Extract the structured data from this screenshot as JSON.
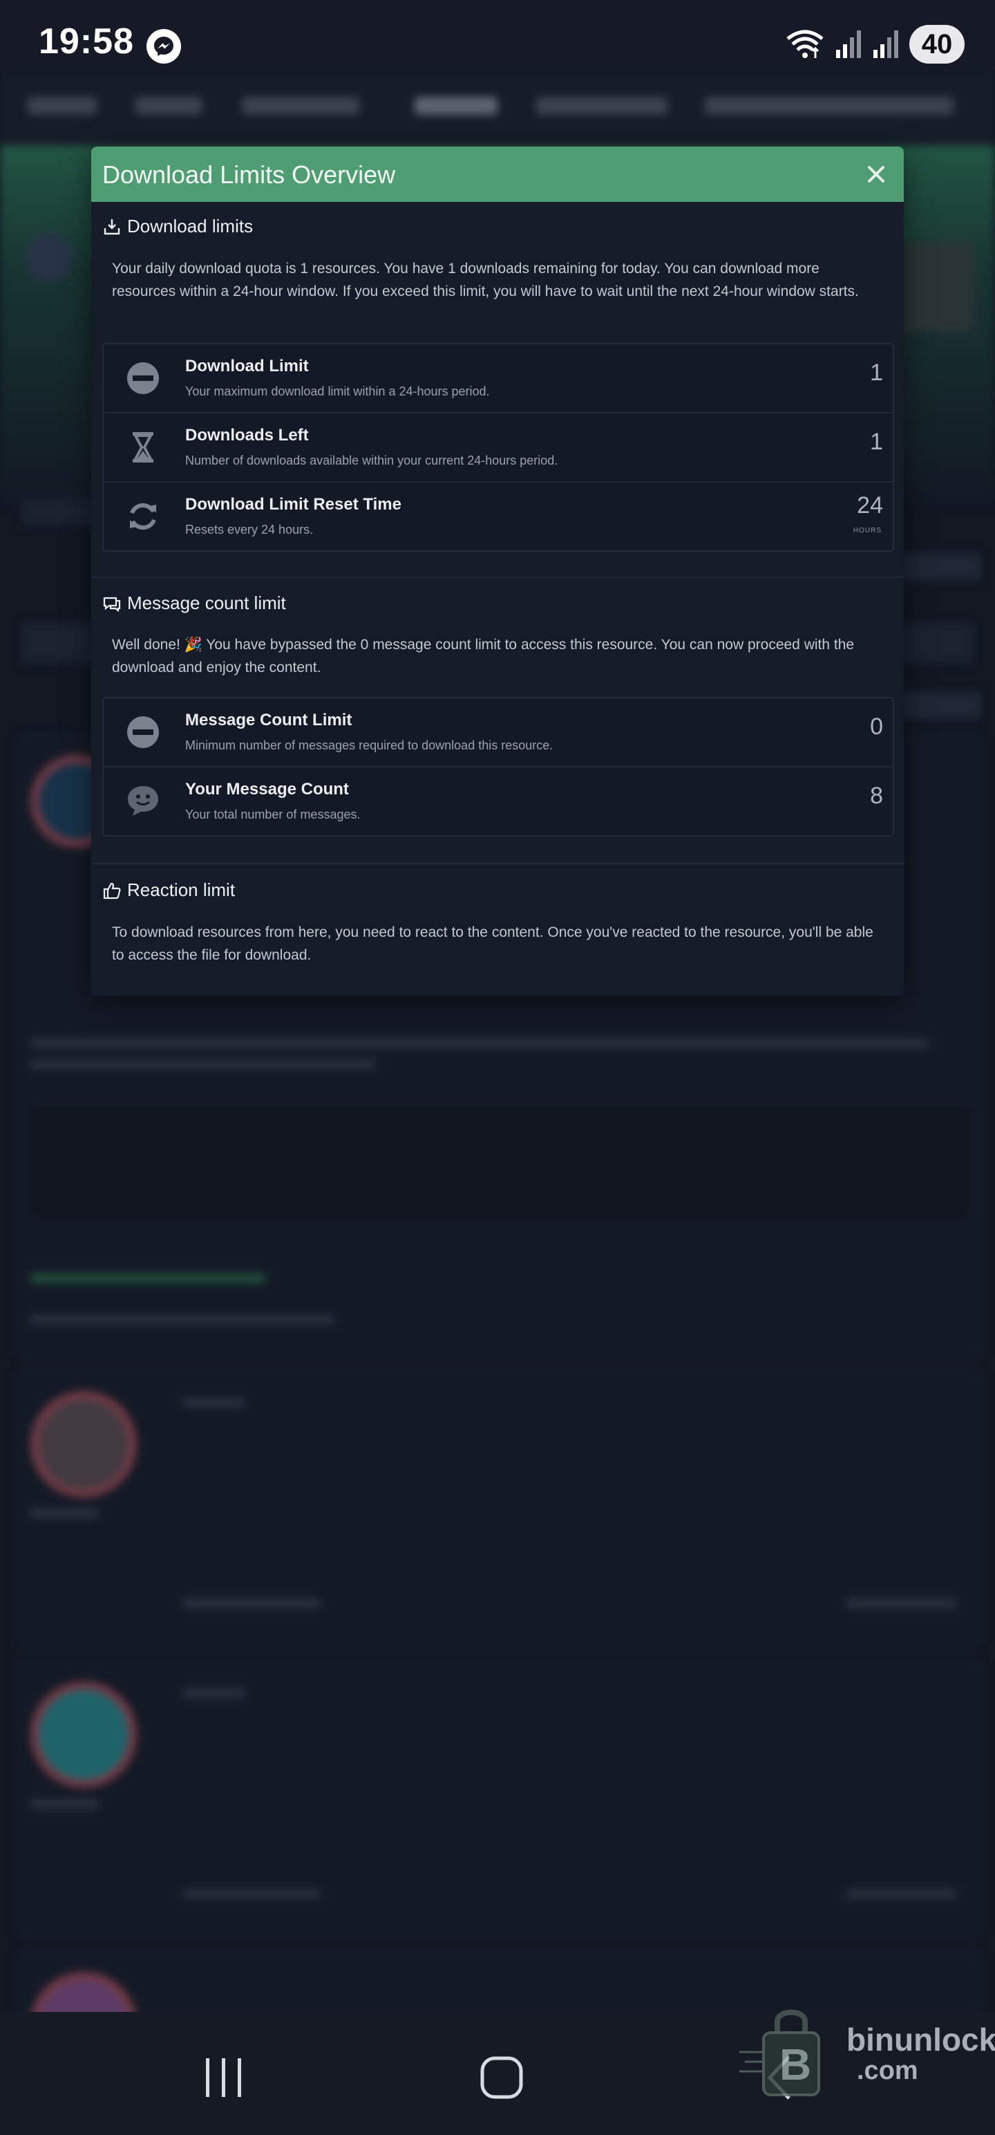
{
  "status_bar": {
    "time": "19:58",
    "battery": "40"
  },
  "modal": {
    "title": "Download Limits Overview",
    "download_section": {
      "heading": "Download limits",
      "description": "Your daily download quota is 1 resources. You have 1 downloads remaining for today. You can download more resources within a 24-hour window. If you exceed this limit, you will have to wait until the next 24-hour window starts.",
      "rows": [
        {
          "title": "Download Limit",
          "desc": "Your maximum download limit within a 24-hours period.",
          "value": "1",
          "icon": "minus-circle-icon"
        },
        {
          "title": "Downloads Left",
          "desc": "Number of downloads available within your current 24-hours period.",
          "value": "1",
          "icon": "hourglass-icon"
        },
        {
          "title": "Download Limit Reset Time",
          "desc": "Resets every 24 hours.",
          "value": "24",
          "sub": "HOURS",
          "icon": "refresh-icon"
        }
      ]
    },
    "message_section": {
      "heading": "Message count limit",
      "description": "Well done! 🎉 You have bypassed the 0 message count limit to access this resource. You can now proceed with the download and enjoy the content.",
      "rows": [
        {
          "title": "Message Count Limit",
          "desc": "Minimum number of messages required to download this resource.",
          "value": "0",
          "icon": "minus-circle-icon"
        },
        {
          "title": "Your Message Count",
          "desc": "Your total number of messages.",
          "value": "8",
          "icon": "smile-chat-icon"
        }
      ]
    },
    "reaction_section": {
      "heading": "Reaction limit",
      "description": "To download resources from here, you need to react to the content. Once you've reacted to the resource, you'll be able to access the file for download."
    }
  },
  "watermark": {
    "line1": "binunlock",
    "line2": ".com"
  },
  "colors": {
    "header_green": "#4f9d73",
    "modal_bg": "#151b27",
    "page_bg": "#121722"
  }
}
